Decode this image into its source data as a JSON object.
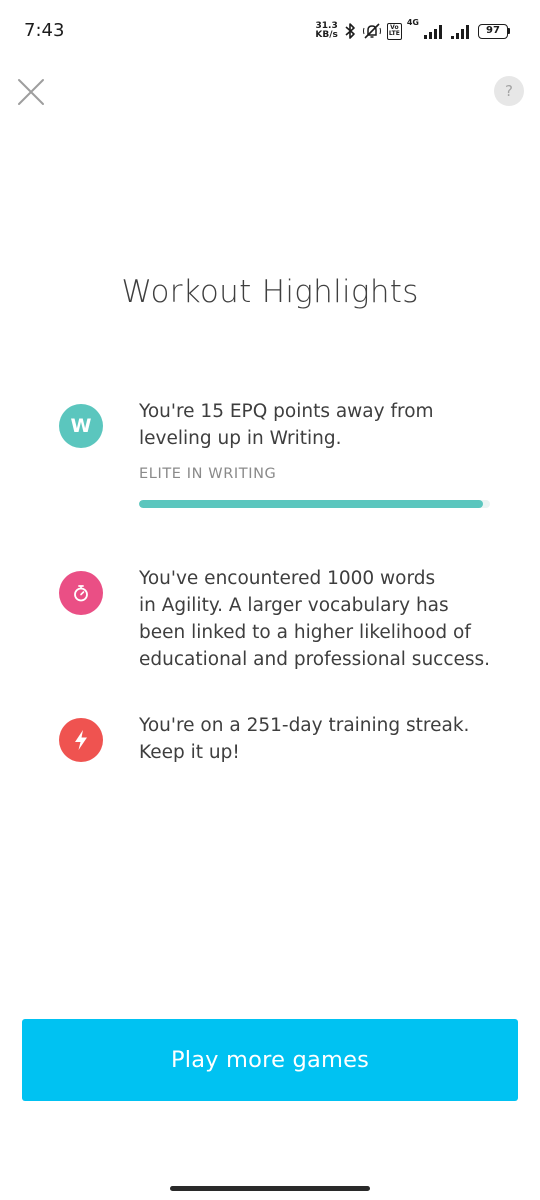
{
  "status_bar": {
    "time": "7:43",
    "net_speed_value": "31.3",
    "net_speed_unit": "KB/s",
    "volte_top": "Vo",
    "volte_bottom": "LTE",
    "network_type": "4G",
    "battery": "97"
  },
  "header": {
    "close_icon": "close-x-icon",
    "help_label": "?"
  },
  "page": {
    "title": "Workout Highlights"
  },
  "highlights": [
    {
      "icon": "writing-letter-icon",
      "icon_letter": "W",
      "icon_color": "#5bc6be",
      "lines": [
        "You're 15 EPQ points away from",
        "leveling up in Writing."
      ],
      "level_label": "ELITE IN WRITING",
      "progress": 0.98,
      "progress_color": "#5bc6be"
    },
    {
      "icon": "stopwatch-icon",
      "icon_color": "#ea4f85",
      "lines": [
        "You've encountered 1000 words",
        "in Agility. A larger vocabulary has",
        "been linked to a higher likelihood of",
        "educational and professional success."
      ]
    },
    {
      "icon": "lightning-bolt-icon",
      "icon_color": "#ef5350",
      "lines": [
        "You're on a 251-day training streak.",
        "Keep it up!"
      ]
    }
  ],
  "footer": {
    "play_button_label": "Play more games",
    "play_button_color": "#00c2f2"
  }
}
